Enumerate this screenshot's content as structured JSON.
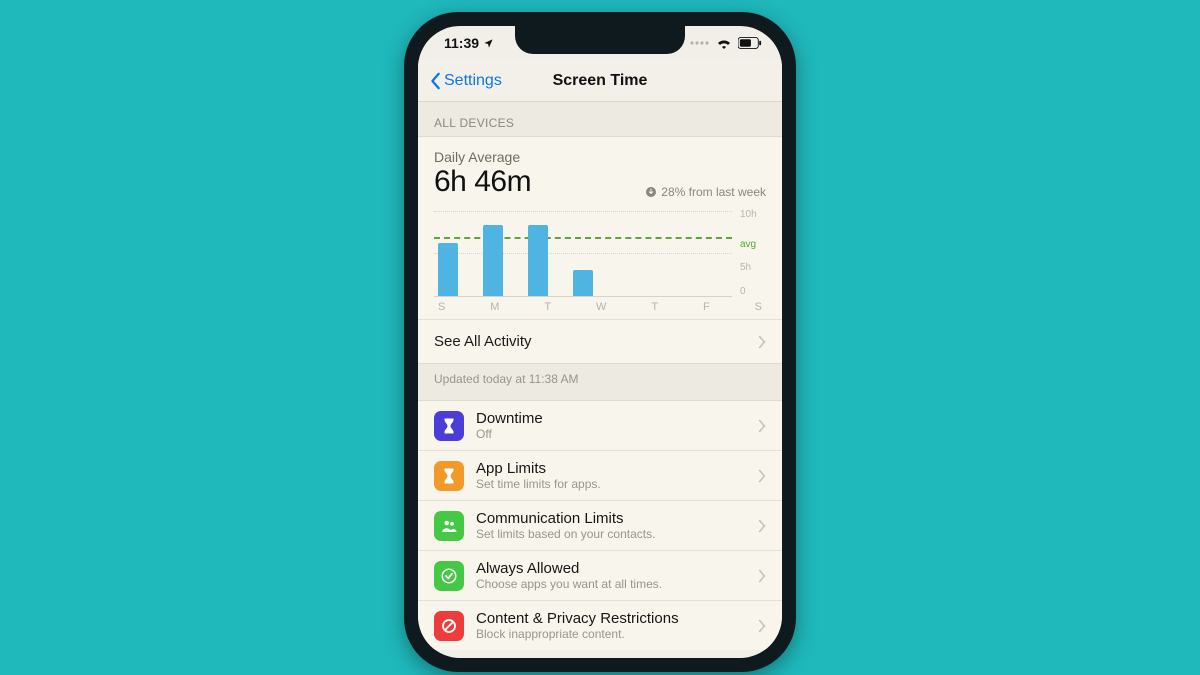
{
  "status": {
    "time": "11:39"
  },
  "nav": {
    "back_label": "Settings",
    "title": "Screen Time"
  },
  "section_header": "ALL DEVICES",
  "summary": {
    "label": "Daily Average",
    "value": "6h 46m",
    "delta": "28% from last week"
  },
  "chart_data": {
    "type": "bar",
    "categories": [
      "S",
      "M",
      "T",
      "W",
      "T",
      "F",
      "S"
    ],
    "values": [
      6.2,
      8.2,
      8.3,
      3.0,
      0,
      0,
      0
    ],
    "ylim": [
      0,
      10
    ],
    "y_ticks": [
      "10h",
      "avg",
      "5h",
      "0"
    ],
    "avg_value": 6.77,
    "title": "Daily Average",
    "xlabel": "",
    "ylabel": ""
  },
  "see_all": "See All Activity",
  "updated": "Updated today at 11:38 AM",
  "items": [
    {
      "title": "Downtime",
      "sub": "Off",
      "color": "#4b3ed6",
      "icon": "hourglass"
    },
    {
      "title": "App Limits",
      "sub": "Set time limits for apps.",
      "color": "#f19a2a",
      "icon": "hourglass"
    },
    {
      "title": "Communication Limits",
      "sub": "Set limits based on your contacts.",
      "color": "#45c844",
      "icon": "people"
    },
    {
      "title": "Always Allowed",
      "sub": "Choose apps you want at all times.",
      "color": "#45c844",
      "icon": "check"
    },
    {
      "title": "Content & Privacy Restrictions",
      "sub": "Block inappropriate content.",
      "color": "#ee3b3b",
      "icon": "block"
    }
  ]
}
